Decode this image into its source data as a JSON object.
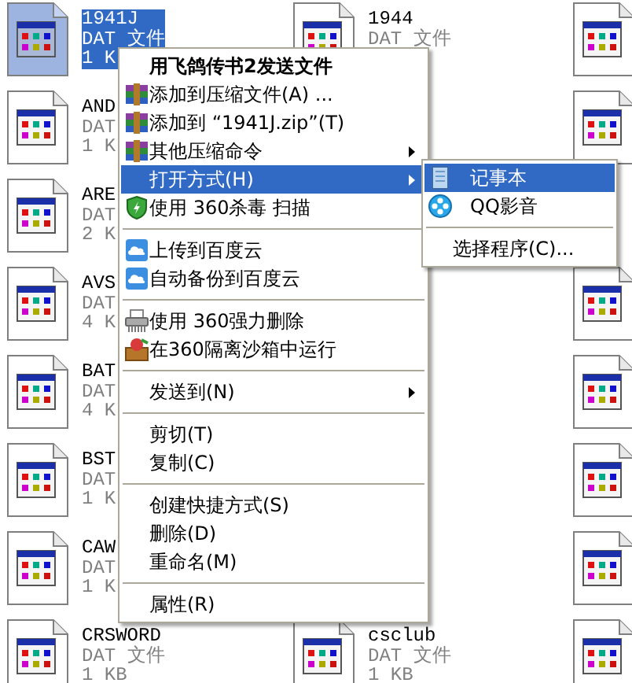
{
  "files": [
    {
      "kind": "file",
      "name": "1941J",
      "type": "DAT 文件",
      "size": "1 K",
      "selected": true
    },
    {
      "kind": "file",
      "name": "1944",
      "type": "DAT 文件",
      "selected": false
    },
    {
      "kind": "icon_only",
      "selected": false
    },
    {
      "kind": "file",
      "name": "AND",
      "type": "DAT",
      "size": "1 K",
      "selected": false
    },
    {
      "kind": "covered"
    },
    {
      "kind": "icon_only",
      "selected": false
    },
    {
      "kind": "file",
      "name": "ARE",
      "type": "DAT",
      "size": "2 K",
      "selected": false
    },
    {
      "kind": "covered"
    },
    {
      "kind": "covered"
    },
    {
      "kind": "file",
      "name": "AVS",
      "type": "DAT",
      "size": "4 K",
      "selected": false
    },
    {
      "kind": "covered"
    },
    {
      "kind": "icon_only",
      "selected": false
    },
    {
      "kind": "file",
      "name": "BAT",
      "type": "DAT",
      "size": "4 K",
      "selected": false
    },
    {
      "kind": "covered"
    },
    {
      "kind": "icon_only",
      "selected": false
    },
    {
      "kind": "file",
      "name": "BST",
      "type": "DAT",
      "size": "1 K",
      "selected": false
    },
    {
      "kind": "covered"
    },
    {
      "kind": "icon_only",
      "selected": false
    },
    {
      "kind": "file",
      "name": "CAW",
      "type": "DAT",
      "size": "1 K",
      "selected": false
    },
    {
      "kind": "covered"
    },
    {
      "kind": "icon_only",
      "selected": false
    },
    {
      "kind": "file",
      "name": "CRSWORD",
      "type": "DAT 文件",
      "size": "1 KB",
      "selected": false
    },
    {
      "kind": "file",
      "name": "csclub",
      "type": "DAT 文件",
      "size": "1 KB",
      "selected": false
    },
    {
      "kind": "icon_only",
      "selected": false
    }
  ],
  "context_menu": {
    "items": [
      {
        "kind": "header",
        "label": "用飞鸽传书2发送文件",
        "selected": false
      },
      {
        "kind": "archive",
        "label": "添加到压缩文件(A) ...",
        "selected": false
      },
      {
        "kind": "archive",
        "label": "添加到 “1941J.zip”(T)",
        "selected": false
      },
      {
        "kind": "archive",
        "label": "其他压缩命令",
        "submenu": true,
        "selected": false
      },
      {
        "kind": "plain",
        "label": "打开方式(H)",
        "submenu": true,
        "selected": true
      },
      {
        "kind": "shield",
        "label": "使用 360杀毒 扫描",
        "selected": false
      },
      {
        "kind": "separator"
      },
      {
        "kind": "cloud",
        "label": "上传到百度云",
        "selected": false
      },
      {
        "kind": "cloud",
        "label": "自动备份到百度云",
        "selected": false
      },
      {
        "kind": "separator"
      },
      {
        "kind": "shredder",
        "label": "使用 360强力删除",
        "selected": false
      },
      {
        "kind": "sandbox",
        "label": "在360隔离沙箱中运行",
        "selected": false
      },
      {
        "kind": "separator"
      },
      {
        "kind": "plain",
        "label": "发送到(N)",
        "submenu": true,
        "selected": false
      },
      {
        "kind": "separator"
      },
      {
        "kind": "plain",
        "label": "剪切(T)",
        "selected": false
      },
      {
        "kind": "plain",
        "label": "复制(C)",
        "selected": false
      },
      {
        "kind": "separator"
      },
      {
        "kind": "plain",
        "label": "创建快捷方式(S)",
        "selected": false
      },
      {
        "kind": "plain",
        "label": "删除(D)",
        "selected": false
      },
      {
        "kind": "plain",
        "label": "重命名(M)",
        "selected": false
      },
      {
        "kind": "separator"
      },
      {
        "kind": "plain",
        "label": "属性(R)",
        "selected": false
      }
    ]
  },
  "open_with_submenu": {
    "items": [
      {
        "kind": "notepad",
        "label": "记事本",
        "selected": true
      },
      {
        "kind": "player",
        "label": "QQ影音",
        "selected": false
      },
      {
        "kind": "separator"
      },
      {
        "kind": "plain",
        "label": "选择程序(C)...",
        "selected": false
      }
    ]
  }
}
